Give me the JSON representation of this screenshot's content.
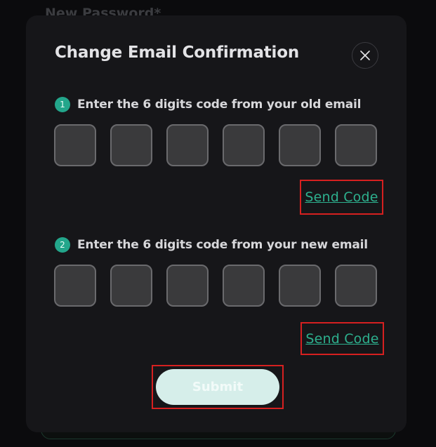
{
  "background": {
    "label": "New Password*"
  },
  "modal": {
    "title": "Change Email Confirmation",
    "close_icon": "close-icon",
    "steps": [
      {
        "number": "1",
        "instruction": "Enter the 6 digits code from your old email",
        "code_digits": [
          "",
          "",
          "",
          "",
          "",
          ""
        ],
        "send_code_label": "Send Code"
      },
      {
        "number": "2",
        "instruction": "Enter the 6 digits code from your new email",
        "code_digits": [
          "",
          "",
          "",
          "",
          "",
          ""
        ],
        "send_code_label": "Send Code"
      }
    ],
    "submit_label": "Submit"
  },
  "colors": {
    "accent": "#23a68b",
    "link": "#2db08e",
    "modal_bg": "#161619",
    "page_bg": "#0b0b0d",
    "highlight_box": "#d62020",
    "submit_bg": "#d6eeea"
  }
}
